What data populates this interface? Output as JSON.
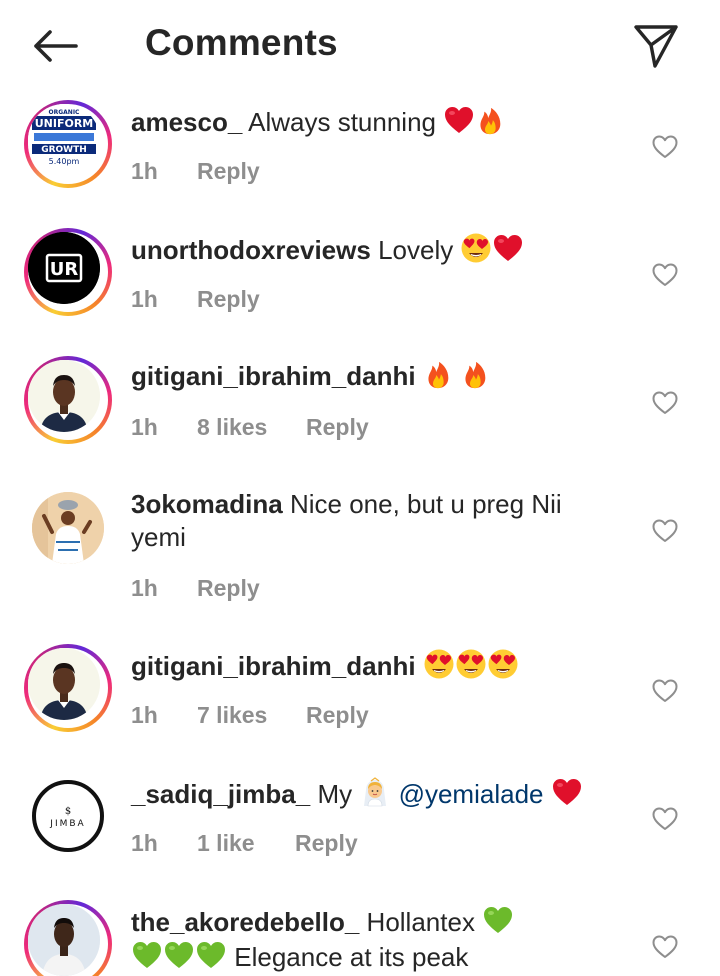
{
  "header": {
    "title": "Comments"
  },
  "icons": {
    "back": "arrow-left-icon",
    "share": "paper-plane-icon",
    "like": "heart-outline-icon"
  },
  "colors": {
    "text": "#262626",
    "meta": "#8e8e8e",
    "mention": "#00376b",
    "story_ring_start": "#f9ce34",
    "story_ring_end": "#ee2a7b"
  },
  "comments": [
    {
      "username": "amesco_",
      "text": "Always stunning",
      "emojis": [
        "red-heart",
        "fire"
      ],
      "time": "1h",
      "likes": "",
      "reply": "Reply",
      "avatar_text": [
        "ORGANIC",
        "UNIFORM",
        "GROWTH",
        "5.40pm"
      ]
    },
    {
      "username": "unorthodoxreviews",
      "text": "Lovely",
      "emojis": [
        "heart-eyes",
        "red-heart"
      ],
      "time": "1h",
      "likes": "",
      "reply": "Reply",
      "avatar_text": [
        "UR"
      ]
    },
    {
      "username": "gitigani_ibrahim_danhi",
      "text": "",
      "emojis": [
        "fire",
        "fire"
      ],
      "time": "1h",
      "likes": "8 likes",
      "reply": "Reply"
    },
    {
      "username": "3okomadina",
      "text": "Nice one, but u preg Nii",
      "text_line2": "yemi",
      "time": "1h",
      "likes": "",
      "reply": "Reply"
    },
    {
      "username": "gitigani_ibrahim_danhi",
      "text": "",
      "emojis": [
        "heart-eyes",
        "heart-eyes",
        "heart-eyes"
      ],
      "time": "1h",
      "likes": "7 likes",
      "reply": "Reply"
    },
    {
      "username": "_sadiq_jimba_",
      "text": "My",
      "emojis": [
        "bride",
        "red-heart"
      ],
      "mention": "@yemialade",
      "time": "1h",
      "likes": "1 like",
      "reply": "Reply",
      "avatar_text": [
        "$",
        "JIMBA"
      ]
    },
    {
      "username": "the_akoredebello_",
      "text": "Hollantex",
      "text_line2": "Elegance at its peak",
      "emojis": [
        "green-heart",
        "green-heart",
        "green-heart",
        "green-heart"
      ],
      "time": "",
      "likes": "",
      "reply": ""
    }
  ]
}
